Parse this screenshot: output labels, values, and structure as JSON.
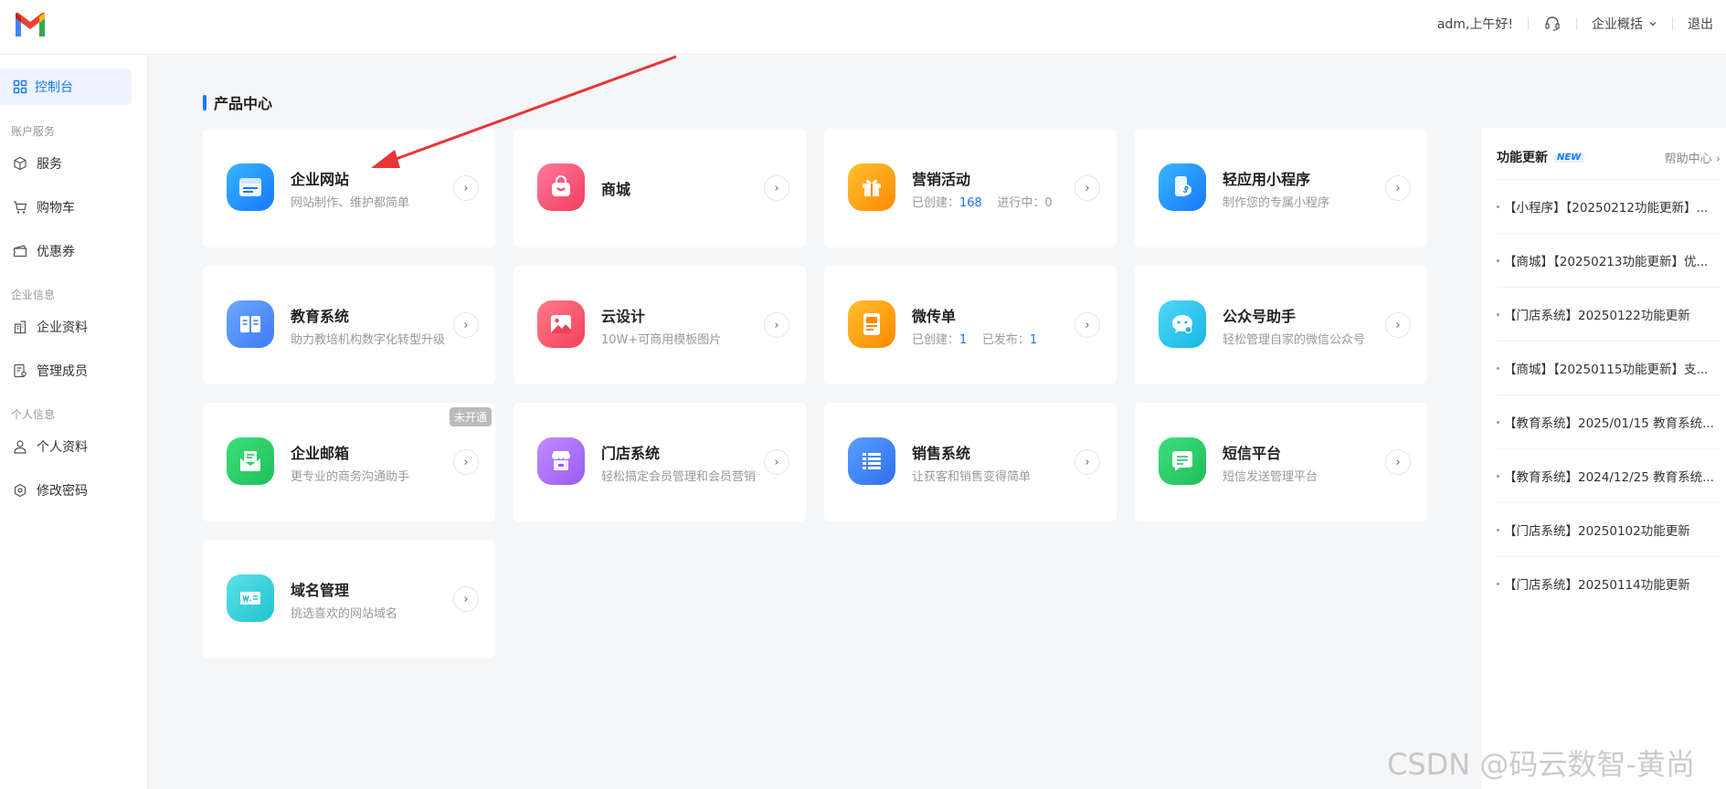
{
  "header": {
    "greeting": "adm,上午好!",
    "enterprise_menu": "企业概括",
    "logout": "退出"
  },
  "sidebar": {
    "active": "控制台",
    "groups": [
      "账户服务",
      "企业信息",
      "个人信息"
    ],
    "items": [
      {
        "label": "服务",
        "icon": "box-icon"
      },
      {
        "label": "购物车",
        "icon": "cart-icon"
      },
      {
        "label": "优惠券",
        "icon": "coupon-icon"
      },
      {
        "label": "企业资料",
        "icon": "building-icon"
      },
      {
        "label": "管理成员",
        "icon": "members-icon"
      },
      {
        "label": "个人资料",
        "icon": "user-icon"
      },
      {
        "label": "修改密码",
        "icon": "lock-settings-icon"
      }
    ]
  },
  "main": {
    "section_title": "产品中心",
    "cards": [
      {
        "title": "企业网站",
        "desc": "网站制作、维护都简单"
      },
      {
        "title": "商城",
        "desc": ""
      },
      {
        "title": "营销活动",
        "desc_prefix": "已创建：",
        "count1": "168",
        "desc_mid": "进行中：",
        "count2": "0"
      },
      {
        "title": "轻应用小程序",
        "desc": "制作您的专属小程序"
      },
      {
        "title": "教育系统",
        "desc": "助力教培机构数字化转型升级"
      },
      {
        "title": "云设计",
        "desc": "10W+可商用模板图片"
      },
      {
        "title": "微传单",
        "desc_prefix": "已创建：",
        "count1": "1",
        "desc_mid": "已发布：",
        "count2": "1"
      },
      {
        "title": "公众号助手",
        "desc": "轻松管理自家的微信公众号"
      },
      {
        "title": "企业邮箱",
        "desc": "更专业的商务沟通助手",
        "badge": "未开通"
      },
      {
        "title": "门店系统",
        "desc": "轻松搞定会员管理和会员营销"
      },
      {
        "title": "销售系统",
        "desc": "让获客和销售变得简单"
      },
      {
        "title": "短信平台",
        "desc": "短信发送管理平台"
      },
      {
        "title": "域名管理",
        "desc": "挑选喜欢的网站域名"
      }
    ],
    "arrow_glyph": "›"
  },
  "updates": {
    "title": "功能更新",
    "new_badge": "NEW",
    "help": "帮助中心 ›",
    "items": [
      "【小程序】【20250212功能更新】...",
      "【商城】【20250213功能更新】优...",
      "【门店系统】20250122功能更新",
      "【商城】【20250115功能更新】支...",
      "【教育系统】2025/01/15 教育系统...",
      "【教育系统】2024/12/25 教育系统...",
      "【门店系统】20250102功能更新",
      "【门店系统】20250114功能更新"
    ]
  },
  "watermark": "CSDN @码云数智-黄尚",
  "colors": {
    "accent": "#1677ff",
    "annotation_arrow": "#e8353a"
  }
}
